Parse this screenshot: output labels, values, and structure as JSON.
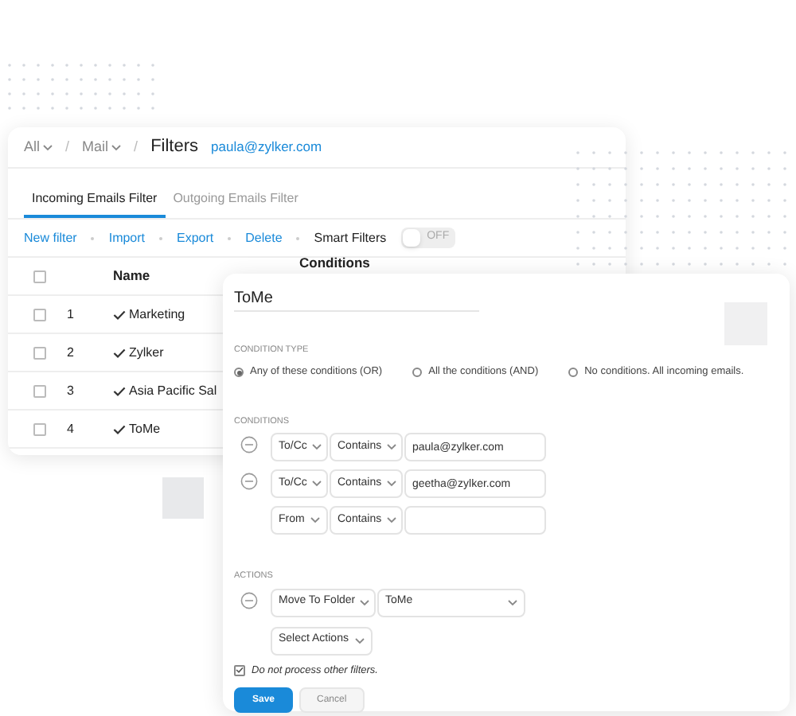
{
  "breadcrumb": [
    {
      "label": "All",
      "dropdown": true,
      "separator": "/"
    },
    {
      "label": "Mail",
      "dropdown": true,
      "separator": "/"
    }
  ],
  "page_title": "Filters",
  "account": "paula@zylker.com",
  "tabs": [
    {
      "label": "Incoming Emails Filter",
      "selected": true
    },
    {
      "label": "Outgoing Emails Filter",
      "selected": false
    }
  ],
  "toolbar": {
    "actions": [
      "New filter",
      "Import",
      "Export",
      "Delete"
    ],
    "smart_filters": {
      "label": "Smart Filters",
      "on": false,
      "state_text": "OFF"
    }
  },
  "table": {
    "select_all_checked": false,
    "columns": [
      "Name",
      "Conditions"
    ],
    "rows": [
      {
        "checked": false,
        "number": "1",
        "enabled": true,
        "name": "Marketing"
      },
      {
        "checked": false,
        "number": "2",
        "enabled": true,
        "name": "Zylker"
      },
      {
        "checked": false,
        "number": "3",
        "enabled": true,
        "name": "Asia Pacific Sal"
      },
      {
        "checked": false,
        "number": "4",
        "enabled": true,
        "name": "ToMe"
      }
    ]
  },
  "editor": {
    "name": "ToMe",
    "condition_type": {
      "label": "CONDITION TYPE",
      "options": [
        {
          "label": "Any of these conditions (OR)",
          "selected": true
        },
        {
          "label": "All the conditions (AND)",
          "selected": false
        },
        {
          "label": "No conditions. All incoming emails.",
          "selected": false
        }
      ]
    },
    "conditions": {
      "label": "CONDITIONS",
      "rows": [
        {
          "removable": true,
          "field": "To/Cc",
          "operator": "Contains",
          "value": "paula@zylker.com"
        },
        {
          "removable": true,
          "field": "To/Cc",
          "operator": "Contains",
          "value": "geetha@zylker.com"
        },
        {
          "removable": false,
          "field": "From",
          "operator": "Contains"
        }
      ]
    },
    "actions": {
      "label": "ACTIONS",
      "rows": [
        {
          "removable": true,
          "action": "Move To Folder",
          "target": "ToMe"
        },
        {
          "removable": false,
          "action": "Select Actions"
        }
      ]
    },
    "stop_processing": {
      "label": "Do not process other filters.",
      "checked": true
    },
    "buttons": [
      {
        "label": "Save",
        "kind": "primary"
      },
      {
        "label": "Cancel",
        "kind": "secondary"
      }
    ]
  }
}
